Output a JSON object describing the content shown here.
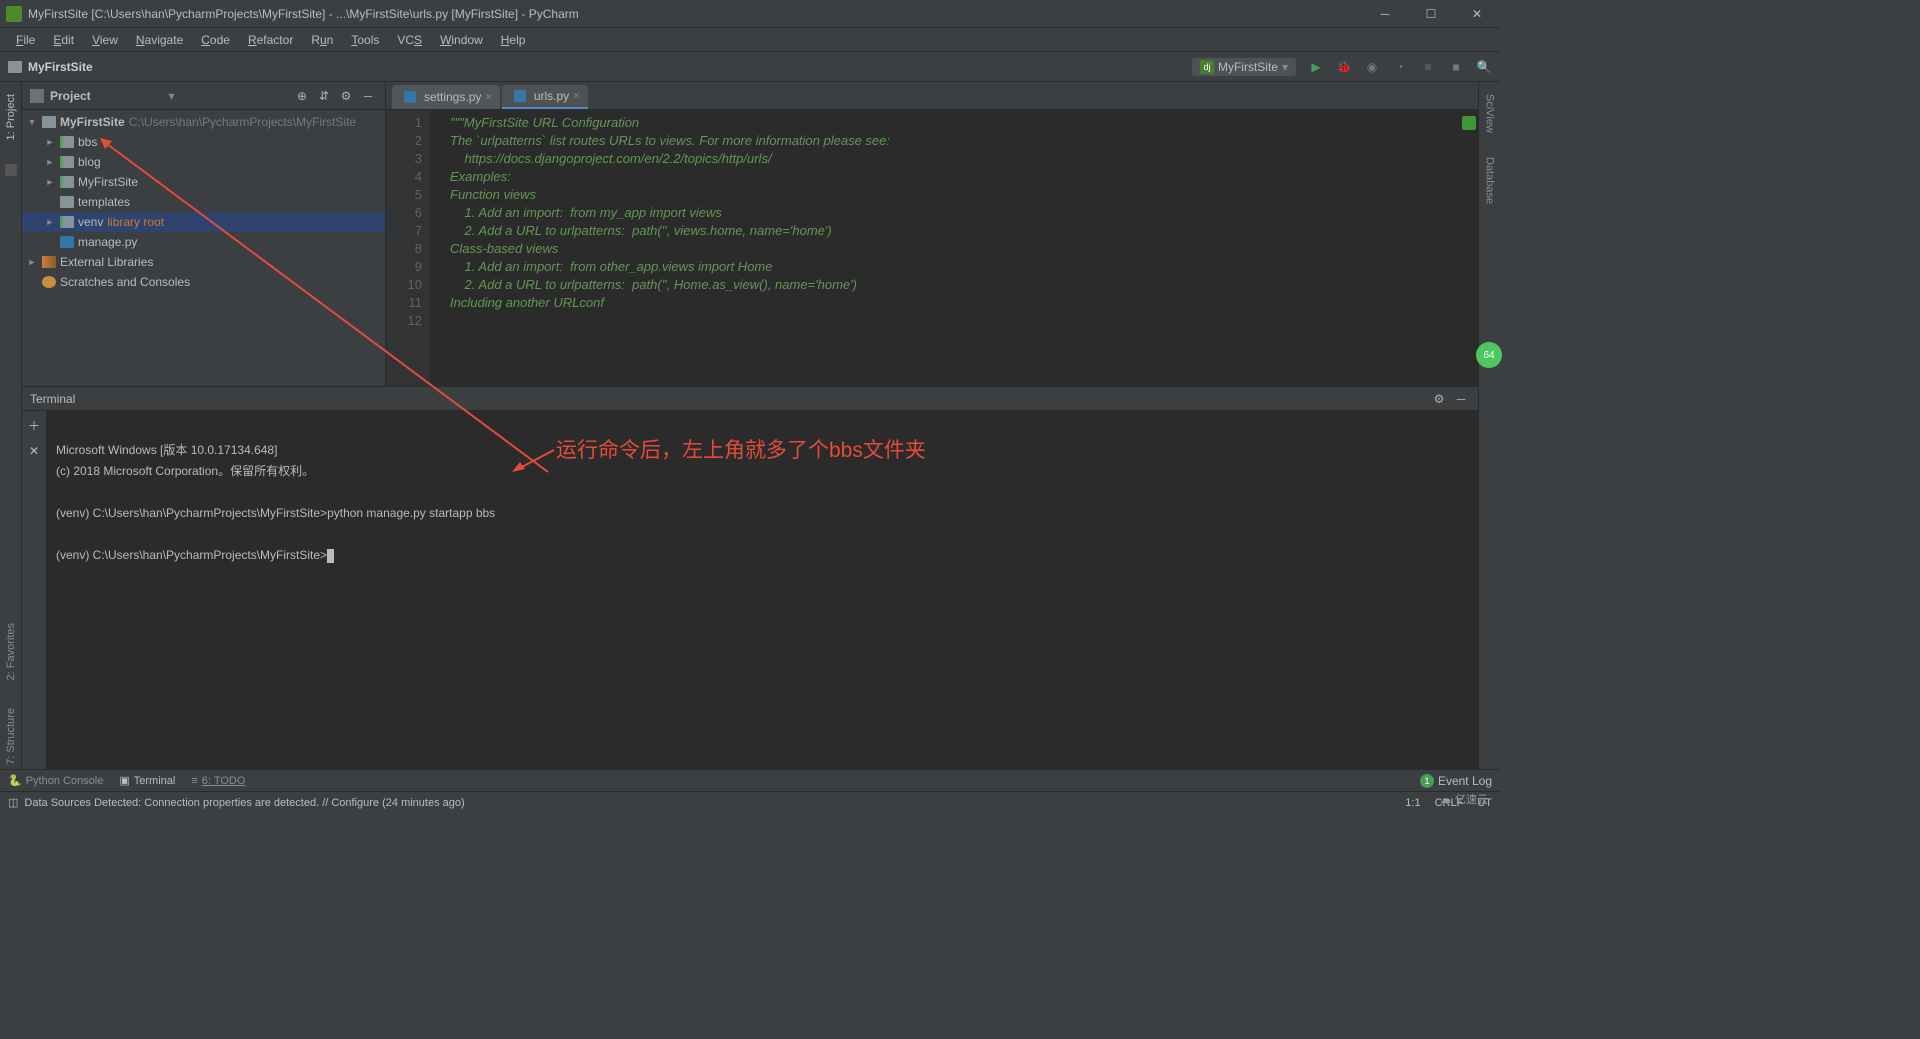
{
  "window": {
    "title": "MyFirstSite [C:\\Users\\han\\PycharmProjects\\MyFirstSite] - ...\\MyFirstSite\\urls.py [MyFirstSite] - PyCharm"
  },
  "menu": [
    "File",
    "Edit",
    "View",
    "Navigate",
    "Code",
    "Refactor",
    "Run",
    "Tools",
    "VCS",
    "Window",
    "Help"
  ],
  "navbar": {
    "breadcrumb": "MyFirstSite",
    "run_config": "MyFirstSite"
  },
  "project": {
    "title": "Project",
    "tree": {
      "root": {
        "name": "MyFirstSite",
        "hint": "C:\\Users\\han\\PycharmProjects\\MyFirstSite"
      },
      "children": [
        {
          "name": "bbs",
          "type": "pkg",
          "arrow": "►"
        },
        {
          "name": "blog",
          "type": "pkg",
          "arrow": "►"
        },
        {
          "name": "MyFirstSite",
          "type": "pkg",
          "arrow": "►"
        },
        {
          "name": "templates",
          "type": "folder",
          "arrow": ""
        },
        {
          "name": "venv",
          "type": "pkg",
          "arrow": "►",
          "hint": "library root"
        },
        {
          "name": "manage.py",
          "type": "py",
          "arrow": ""
        }
      ],
      "external": "External Libraries",
      "scratches": "Scratches and Consoles"
    }
  },
  "tabs": [
    {
      "label": "settings.py",
      "active": false
    },
    {
      "label": "urls.py",
      "active": true
    }
  ],
  "editor": {
    "lines": [
      "\"\"\"MyFirstSite URL Configuration",
      "",
      "The `urlpatterns` list routes URLs to views. For more information please see:",
      "    https://docs.djangoproject.com/en/2.2/topics/http/urls/",
      "Examples:",
      "Function views",
      "    1. Add an import:  from my_app import views",
      "    2. Add a URL to urlpatterns:  path('', views.home, name='home')",
      "Class-based views",
      "    1. Add an import:  from other_app.views import Home",
      "    2. Add a URL to urlpatterns:  path('', Home.as_view(), name='home')",
      "Including another URLconf"
    ]
  },
  "terminal": {
    "title": "Terminal",
    "lines": [
      "Microsoft Windows [版本 10.0.17134.648]",
      "(c) 2018 Microsoft Corporation。保留所有权利。",
      "",
      "(venv) C:\\Users\\han\\PycharmProjects\\MyFirstSite>python manage.py startapp bbs",
      "",
      "(venv) C:\\Users\\han\\PycharmProjects\\MyFirstSite>"
    ]
  },
  "annotation": "运行命令后，左上角就多了个bbs文件夹",
  "bottom_tools": {
    "python_console": "Python Console",
    "terminal": "Terminal",
    "todo": "6: TODO"
  },
  "status": {
    "message": "Data Sources Detected: Connection properties are detected. // Configure (24 minutes ago)",
    "event_log": "Event Log",
    "pos": "1:1",
    "eol": "CRLF",
    "enc": "UT"
  },
  "left_gutter": [
    "1: Project",
    "2: Favorites",
    "7: Structure"
  ],
  "right_gutter": [
    "SciView",
    "Database"
  ],
  "float_badge": "64",
  "watermark": "亿速云"
}
